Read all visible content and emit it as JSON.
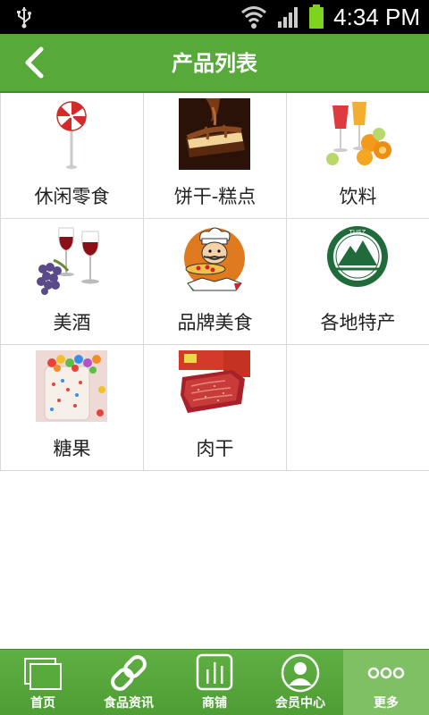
{
  "status_bar": {
    "time": "4:34 PM"
  },
  "header": {
    "title": "产品列表"
  },
  "categories": [
    {
      "label": "休闲零食",
      "icon": "lollipop-image"
    },
    {
      "label": "饼干-糕点",
      "icon": "chocolate-cake-image"
    },
    {
      "label": "饮料",
      "icon": "drinks-oranges-image"
    },
    {
      "label": "美酒",
      "icon": "wine-grapes-image"
    },
    {
      "label": "品牌美食",
      "icon": "chef-pizza-image"
    },
    {
      "label": "各地特产",
      "icon": "mountain-seal-image"
    },
    {
      "label": "糖果",
      "icon": "candy-jar-image"
    },
    {
      "label": "肉干",
      "icon": "jerky-image"
    }
  ],
  "bottom_nav": [
    {
      "label": "首页",
      "icon": "home-pages-icon"
    },
    {
      "label": "食品资讯",
      "icon": "link-icon"
    },
    {
      "label": "商铺",
      "icon": "store-chart-icon"
    },
    {
      "label": "会员中心",
      "icon": "user-icon"
    },
    {
      "label": "更多",
      "icon": "more-dots-icon"
    }
  ],
  "colors": {
    "primary": "#57a93a",
    "active_tab": "#7ec063"
  }
}
